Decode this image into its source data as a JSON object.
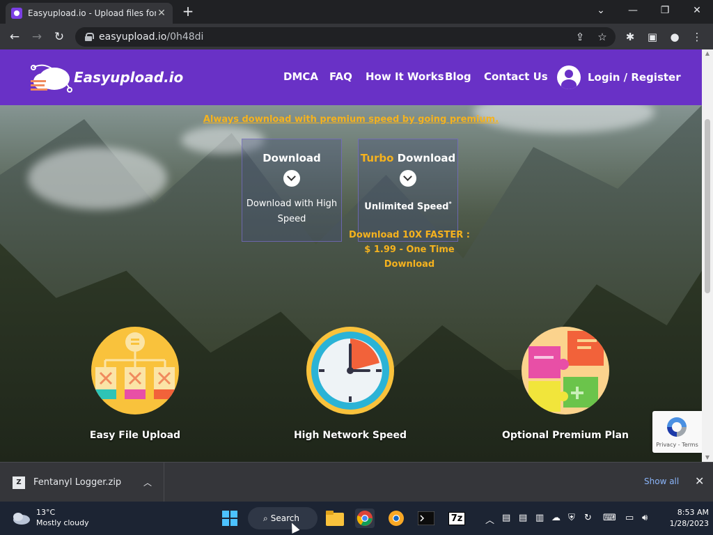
{
  "browser": {
    "tab_title": "Easyupload.io - Upload files for fr",
    "tab_close": "✕",
    "new_tab": "+",
    "url_host": "easyupload.io",
    "url_path": "/0h48di"
  },
  "site": {
    "brand": "Easyupload.io",
    "nav": [
      "DMCA",
      "FAQ",
      "How It Works",
      "Blog",
      "Contact Us"
    ],
    "login": "Login / Register",
    "promo": "Always download with premium speed by going premium.",
    "download_box": {
      "title": "Download",
      "subtitle": "Download with High Speed"
    },
    "turbo_box": {
      "title_accent": "Turbo",
      "title_rest": " Download",
      "subtitle": "Unlimited Speed",
      "asterisk": "*"
    },
    "turbo_offer": [
      "Download 10X FASTER :",
      "$ 1.99 - One Time",
      "Download"
    ],
    "features": [
      {
        "label": "Easy File Upload",
        "icon": "hierarchy-icon"
      },
      {
        "label": "High Network Speed",
        "icon": "clock-icon"
      },
      {
        "label": "Optional Premium Plan",
        "icon": "puzzle-icon"
      }
    ],
    "recaptcha": "Privacy - Terms"
  },
  "downloads_bar": {
    "file_name": "Fentanyl Logger.zip",
    "show_all": "Show all",
    "close": "✕"
  },
  "taskbar": {
    "temperature": "13°C",
    "condition": "Mostly cloudy",
    "search_label": "Search",
    "time": "8:53 AM",
    "date": "1/28/2023",
    "zip_app_label": "7z"
  },
  "colors": {
    "header": "#6931c6",
    "accent": "#f5b21e",
    "taskbar": "#1c2433"
  }
}
